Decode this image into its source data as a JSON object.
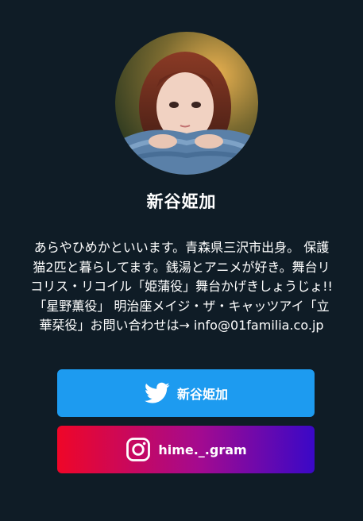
{
  "profile": {
    "name": "新谷姫加",
    "bio": "あらやひめかといいます。青森県三沢市出身。 保護\n猫2匹と暮らしてます。銭湯とアニメが好き。舞台リ\nコリス・リコイル「姫蒲役」舞台かげきしょうじょ!!\n「星野薫役」 明治座メイジ・ザ・キャッツアイ「立\n華栞役」お問い合わせは→ info@01familia.co.jp"
  },
  "links": [
    {
      "label": "新谷姫加",
      "icon": "twitter-bird-icon",
      "color": "#1d9bf0"
    },
    {
      "label": "hime._.gram",
      "icon": "instagram-icon",
      "color": "#ef0628"
    }
  ],
  "colors": {
    "background": "#0f1c26"
  }
}
